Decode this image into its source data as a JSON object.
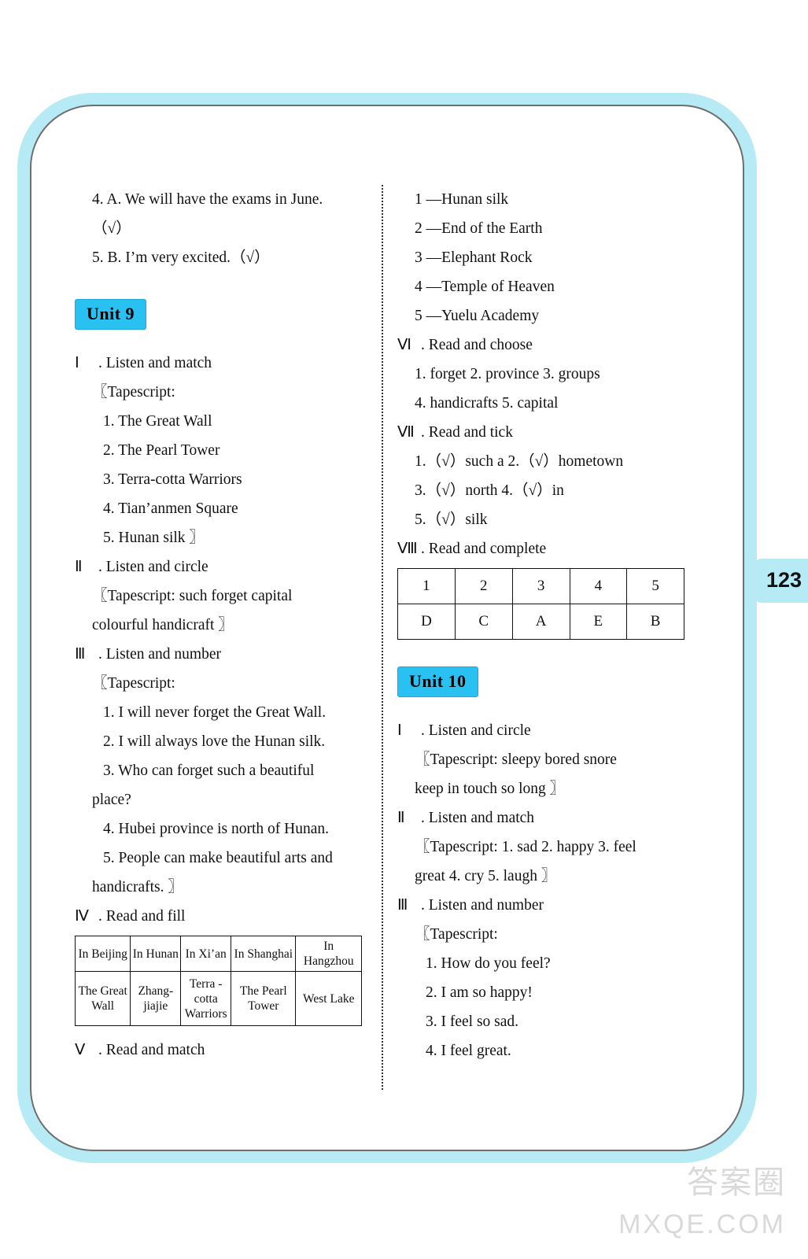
{
  "page": {
    "number": "123",
    "watermark_cn": "答案圈",
    "watermark_en": "MXQE.COM"
  },
  "left_column": {
    "top_answers": [
      "4. A. We will have the exams in June.",
      "（√）",
      "5. B. I’m very excited.（√）"
    ],
    "unit_badge": "Unit 9",
    "sections": [
      {
        "num": "Ⅰ",
        "title": ". Listen and match",
        "lines": [
          "〖Tapescript:",
          "1. The Great Wall",
          "2. The Pearl Tower",
          "3. Terra-cotta Warriors",
          "4. Tian’anmen Square",
          "5. Hunan silk 〗"
        ]
      },
      {
        "num": "Ⅱ",
        "title": ". Listen and circle",
        "lines": [
          "〖Tapescript: such  forget  capital",
          "colourful  handicraft 〗"
        ]
      },
      {
        "num": "Ⅲ",
        "title": ". Listen and number",
        "lines": [
          "〖Tapescript:",
          "1. I will never forget the Great Wall.",
          "2. I will always love the Hunan silk.",
          "3. Who can forget such a beautiful",
          "place?",
          "4. Hubei province is north of Hunan.",
          "5. People can make beautiful arts and",
          "handicrafts. 〗"
        ]
      },
      {
        "num": "Ⅳ",
        "title": ". Read and fill"
      },
      {
        "num": "Ⅴ",
        "title": ". Read and match"
      }
    ],
    "cities_table": {
      "headers": [
        "In Beijing",
        "In Hunan",
        "In Xi’an",
        "In Shanghai",
        "In Hangzhou"
      ],
      "values": [
        "The Great Wall",
        "Zhang-jiajie",
        "Terra - cotta Warriors",
        "The Pearl Tower",
        "West Lake"
      ]
    }
  },
  "right_column": {
    "match_answers": [
      "1 —Hunan silk",
      "2 —End of the Earth",
      "3 —Elephant Rock",
      "4 —Temple of Heaven",
      "5 —Yuelu Academy"
    ],
    "sections": [
      {
        "num": "Ⅵ",
        "title": ". Read and choose",
        "lines": [
          "1. forget   2. province   3. groups",
          "4. handicrafts   5. capital"
        ]
      },
      {
        "num": "Ⅶ",
        "title": ". Read and tick",
        "lines": [
          "1.（√）such a   2.（√）hometown",
          "3.（√）north   4.（√）in",
          "5.（√）silk"
        ]
      },
      {
        "num": "Ⅷ",
        "title": ". Read and complete"
      }
    ],
    "complete_table": {
      "row1": [
        "1",
        "2",
        "3",
        "4",
        "5"
      ],
      "row2": [
        "D",
        "C",
        "A",
        "E",
        "B"
      ]
    },
    "unit_badge": "Unit 10",
    "unit10_sections": [
      {
        "num": "Ⅰ",
        "title": ". Listen and circle",
        "lines": [
          "〖Tapescript: sleepy  bored  snore",
          "keep in touch   so long 〗"
        ]
      },
      {
        "num": "Ⅱ",
        "title": ". Listen and match",
        "lines": [
          "〖Tapescript: 1. sad  2. happy  3. feel",
          "great   4. cry   5. laugh 〗"
        ]
      },
      {
        "num": "Ⅲ",
        "title": ". Listen and number",
        "lines": [
          "〖Tapescript:",
          "1. How do you feel?",
          "2. I am so happy!",
          "3. I feel so sad.",
          "4. I feel great."
        ]
      }
    ]
  }
}
